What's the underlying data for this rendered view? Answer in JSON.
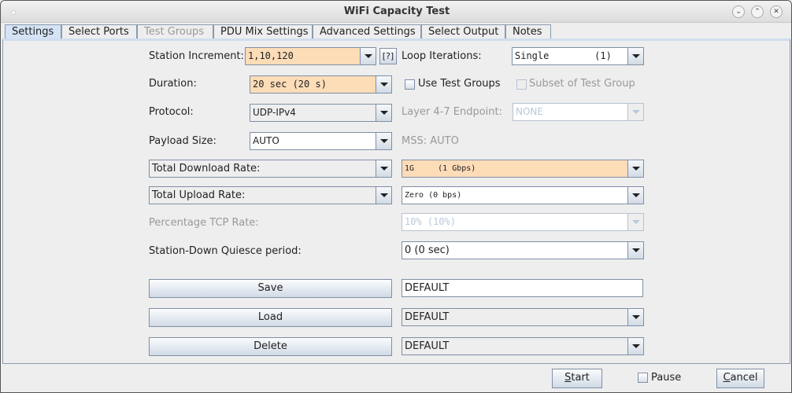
{
  "window": {
    "title": "WiFi Capacity Test",
    "controls": [
      "minimize",
      "maximize",
      "close"
    ]
  },
  "tabs": [
    {
      "label": "Settings",
      "selected": true
    },
    {
      "label": "Select Ports"
    },
    {
      "label": "Test Groups",
      "disabled": true
    },
    {
      "label": "PDU Mix Settings"
    },
    {
      "label": "Advanced Settings"
    },
    {
      "label": "Select Output"
    },
    {
      "label": "Notes"
    }
  ],
  "settings": {
    "station_increment": {
      "label": "Station Increment:",
      "value": "1,10,120",
      "help": "[?]"
    },
    "loop_iterations": {
      "label": "Loop Iterations:",
      "value": "Single        (1)"
    },
    "duration": {
      "label": "Duration:",
      "value": "20 sec (20 s)"
    },
    "use_test_groups": {
      "label": "Use Test Groups",
      "checked": false
    },
    "subset_of_test_group": {
      "label": "Subset of Test Group",
      "checked": false,
      "disabled": true
    },
    "protocol": {
      "label": "Protocol:",
      "value": "UDP-IPv4"
    },
    "layer47_endpoint": {
      "label": "Layer 4-7 Endpoint:",
      "value": "NONE",
      "disabled": true
    },
    "payload_size": {
      "label": "Payload Size:",
      "value": "AUTO"
    },
    "mss": {
      "label": "MSS: AUTO"
    },
    "download_rate": {
      "type": "Total Download Rate:",
      "value": "1G     (1 Gbps)"
    },
    "upload_rate": {
      "type": "Total Upload Rate:",
      "value": "Zero (0 bps)"
    },
    "percentage_tcp_rate": {
      "label": "Percentage TCP Rate:",
      "value": "10% (10%)",
      "disabled": true
    },
    "quiesce": {
      "label": "Station-Down Quiesce period:",
      "value": "0 (0 sec)"
    },
    "save": {
      "label": "Save",
      "value": "DEFAULT"
    },
    "load": {
      "label": "Load",
      "value": "DEFAULT"
    },
    "delete": {
      "label": "Delete",
      "value": "DEFAULT"
    }
  },
  "footer": {
    "start": "Start",
    "pause": "Pause",
    "cancel": "Cancel"
  },
  "colors": {
    "highlight_field": "#fddcb8",
    "selected_tab": "#d4e3f5"
  }
}
